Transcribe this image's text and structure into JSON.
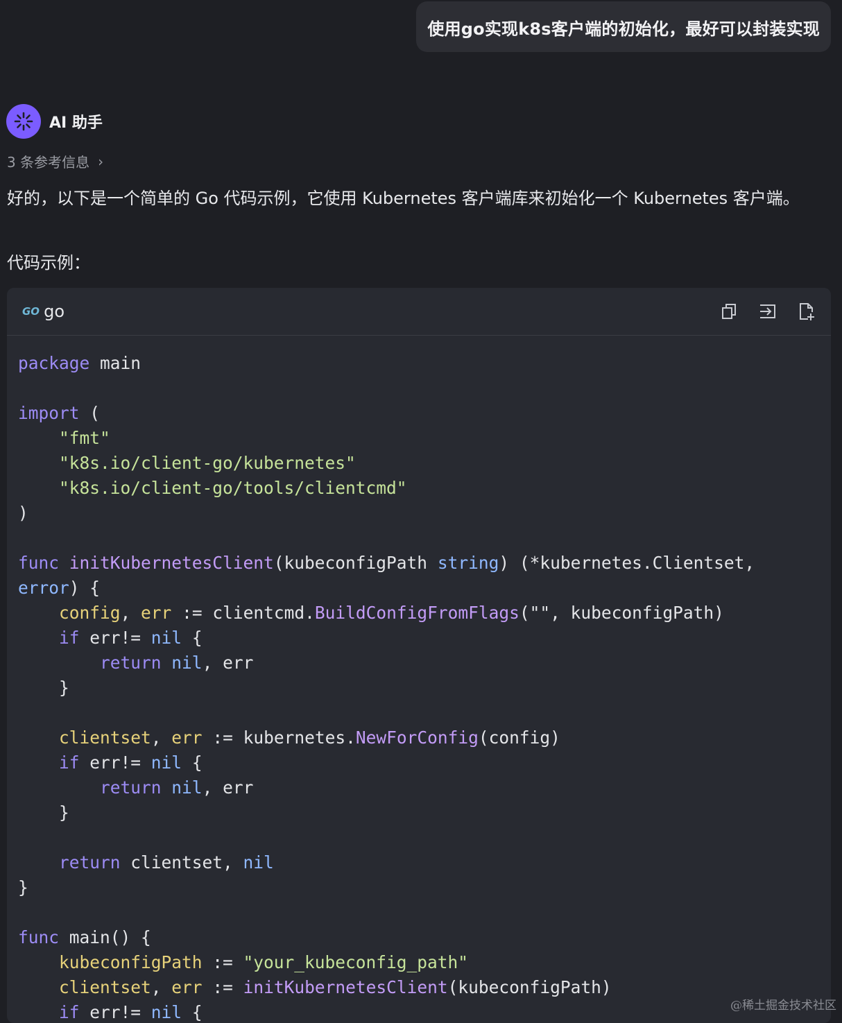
{
  "user_message": "使用go实现k8s客户端的初始化，最好可以封装实现",
  "assistant": {
    "name": "AI 助手",
    "references": "3 条参考信息",
    "intro": "好的，以下是一个简单的 Go 代码示例，它使用 Kubernetes 客户端库来初始化一个 Kubernetes 客户端。",
    "code_label": "代码示例："
  },
  "code_block": {
    "language": "go",
    "language_icon": "GO",
    "tools": [
      "copy-icon",
      "insert-icon",
      "new-file-icon"
    ],
    "tokens": {
      "k_package": "package",
      "main": " main",
      "k_import": "import",
      "lparen": " (",
      "s_fmt": "\"fmt\"",
      "s_kubernetes": "\"k8s.io/client-go/kubernetes\"",
      "s_clientcmd": "\"k8s.io/client-go/tools/clientcmd\"",
      "rparen": ")",
      "k_func1": "func",
      "f_init": "initKubernetesClient",
      "p_open": "(kubeconfigPath ",
      "t_string": "string",
      "p_ret": ") (*kubernetes.Clientset,",
      "t_error": "error",
      "p_brace": ") {",
      "v_config": "config",
      "comma_sp": ", ",
      "v_err1": "err",
      "assign_cc": " := clientcmd.",
      "f_build": "BuildConfigFromFlags",
      "args_build": "(\"\", kubeconfigPath)",
      "k_if1": "if",
      "err_ne": " err!= ",
      "k_nil1": "nil",
      "brace_open": " {",
      "k_return1": "return",
      "k_nil2": "nil",
      "ret_err": ", err",
      "close_brace": "}",
      "v_clientset": "clientset",
      "v_err2": "err",
      "assign_k8s": " := kubernetes.",
      "f_newfor": "NewForConfig",
      "args_newfor": "(config)",
      "k_if2": "if",
      "k_nil3": "nil",
      "k_return2": "return",
      "k_nil4": "nil",
      "k_return3": "return",
      "ret_cs": " clientset, ",
      "k_nil5": "nil",
      "close_func": "}",
      "k_func2": "func",
      "main_sig": " main() {",
      "v_kpath": "kubeconfigPath",
      "assign": " := ",
      "s_path": "\"your_kubeconfig_path\"",
      "v_clientset2": "clientset",
      "v_err3": "err",
      "f_init2": "initKubernetesClient",
      "args_init": "(kubeconfigPath)",
      "k_if3": "if",
      "k_nil6": "nil"
    }
  },
  "watermark": "@稀土掘金技术社区"
}
